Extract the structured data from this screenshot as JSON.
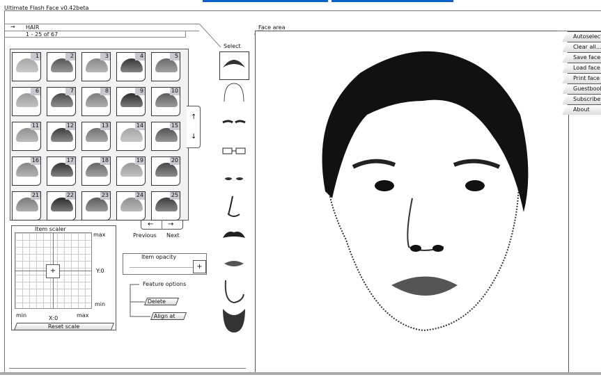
{
  "app_title": "Ultimate Flash Face v0.42beta",
  "category": {
    "arrow": "→",
    "name": "HAIR",
    "range": "1 - 25 of 67"
  },
  "grid": {
    "items": [
      "1",
      "2",
      "3",
      "4",
      "5",
      "6",
      "7",
      "8",
      "9",
      "10",
      "11",
      "12",
      "13",
      "14",
      "15",
      "16",
      "17",
      "18",
      "19",
      "20",
      "21",
      "22",
      "23",
      "24",
      "25"
    ]
  },
  "scroll": {
    "up": "↑",
    "down": "↓"
  },
  "pager": {
    "prev_arrow": "←",
    "next_arrow": "→",
    "prev_label": "Previous",
    "next_label": "Next"
  },
  "select": {
    "title": "Select",
    "features": [
      "hair",
      "head",
      "eyebrows",
      "glasses",
      "eyes",
      "nose",
      "mustache",
      "lips",
      "jaw",
      "beard"
    ]
  },
  "face_area": {
    "title": "Face area"
  },
  "menu": [
    "Autoselect",
    "Clear all...",
    "Save face",
    "Load face",
    "Print face",
    "Guestbook",
    "Subscribe",
    "About"
  ],
  "scaler": {
    "title": "Item scaler",
    "y_max": "max",
    "y_min": "min",
    "x_min": "min",
    "x_max": "max",
    "y_value": "Y:0",
    "x_value": "X:0",
    "reset": "Reset scale"
  },
  "opacity": {
    "title": "Item opacity"
  },
  "feature_options": {
    "title": "Feature options",
    "delete": "Delete",
    "align": "Align at"
  }
}
